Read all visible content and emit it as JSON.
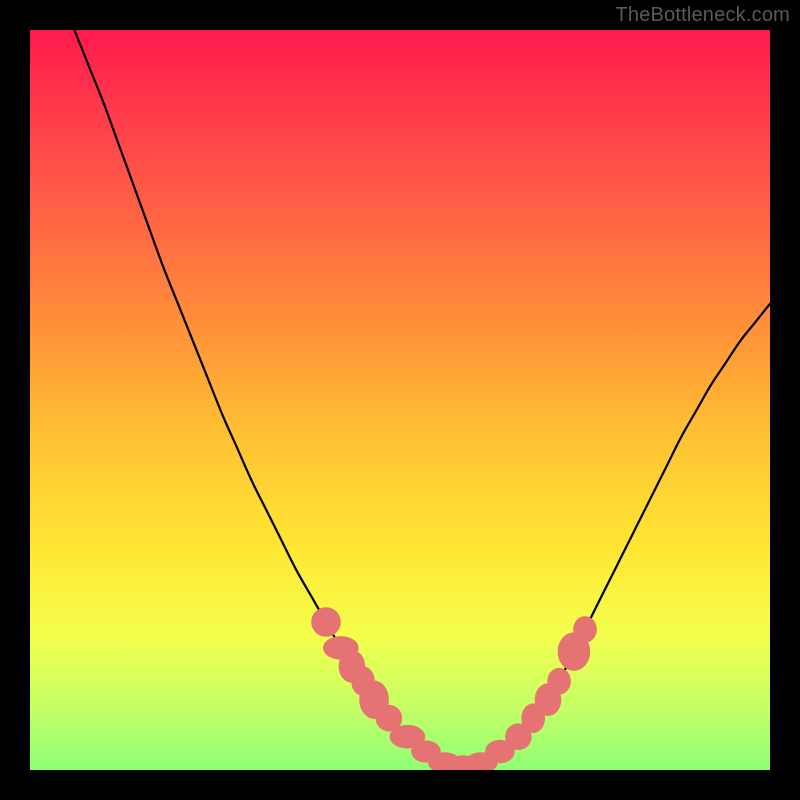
{
  "watermark": "TheBottleneck.com",
  "colors": {
    "curve_stroke": "#000000",
    "marker_fill": "#e57373",
    "marker_stroke": "#d16060"
  },
  "chart_data": {
    "type": "line",
    "title": "",
    "xlabel": "",
    "ylabel": "",
    "xlim": [
      0,
      100
    ],
    "ylim": [
      0,
      100
    ],
    "series": [
      {
        "name": "curve",
        "x": [
          6,
          8,
          10,
          12,
          14,
          16,
          18,
          20,
          22,
          24,
          26,
          28,
          30,
          32,
          34,
          36,
          38,
          40,
          42,
          44,
          46,
          48,
          50,
          52,
          54,
          56,
          58,
          60,
          62,
          64,
          66,
          68,
          70,
          72,
          74,
          76,
          78,
          80,
          82,
          84,
          86,
          88,
          90,
          92,
          94,
          96,
          98,
          100
        ],
        "y": [
          100,
          95,
          90,
          84.5,
          79,
          73.5,
          68,
          63,
          58,
          53,
          48,
          43.5,
          39,
          35,
          31,
          27,
          23.5,
          20,
          16.5,
          13.5,
          10.5,
          8,
          5.5,
          3.5,
          2,
          1,
          0.5,
          0.5,
          1,
          2,
          4,
          6.5,
          9.5,
          13,
          17,
          21,
          25,
          29,
          33,
          37,
          41,
          45,
          48.5,
          52,
          55,
          58,
          60.5,
          63
        ]
      }
    ],
    "markers": [
      {
        "x": 40,
        "y": 20,
        "rx": 2.0,
        "ry": 2.0
      },
      {
        "x": 42,
        "y": 16.5,
        "rx": 2.4,
        "ry": 1.6
      },
      {
        "x": 43.5,
        "y": 14,
        "rx": 1.8,
        "ry": 2.2
      },
      {
        "x": 45,
        "y": 12,
        "rx": 1.6,
        "ry": 2.0
      },
      {
        "x": 46.5,
        "y": 9.5,
        "rx": 2.0,
        "ry": 2.6
      },
      {
        "x": 48.5,
        "y": 7,
        "rx": 1.8,
        "ry": 1.8
      },
      {
        "x": 51,
        "y": 4.5,
        "rx": 2.4,
        "ry": 1.6
      },
      {
        "x": 53.5,
        "y": 2.5,
        "rx": 2.0,
        "ry": 1.5
      },
      {
        "x": 56,
        "y": 1,
        "rx": 2.2,
        "ry": 1.4
      },
      {
        "x": 58.5,
        "y": 0.6,
        "rx": 2.0,
        "ry": 1.4
      },
      {
        "x": 61,
        "y": 1,
        "rx": 2.2,
        "ry": 1.4
      },
      {
        "x": 63.5,
        "y": 2.5,
        "rx": 2.0,
        "ry": 1.6
      },
      {
        "x": 66,
        "y": 4.5,
        "rx": 1.8,
        "ry": 1.8
      },
      {
        "x": 68,
        "y": 7,
        "rx": 1.6,
        "ry": 2.0
      },
      {
        "x": 70,
        "y": 9.5,
        "rx": 1.8,
        "ry": 2.2
      },
      {
        "x": 71.5,
        "y": 12,
        "rx": 1.6,
        "ry": 1.8
      },
      {
        "x": 73.5,
        "y": 16,
        "rx": 2.2,
        "ry": 2.6
      },
      {
        "x": 75,
        "y": 19,
        "rx": 1.6,
        "ry": 1.8
      }
    ]
  }
}
